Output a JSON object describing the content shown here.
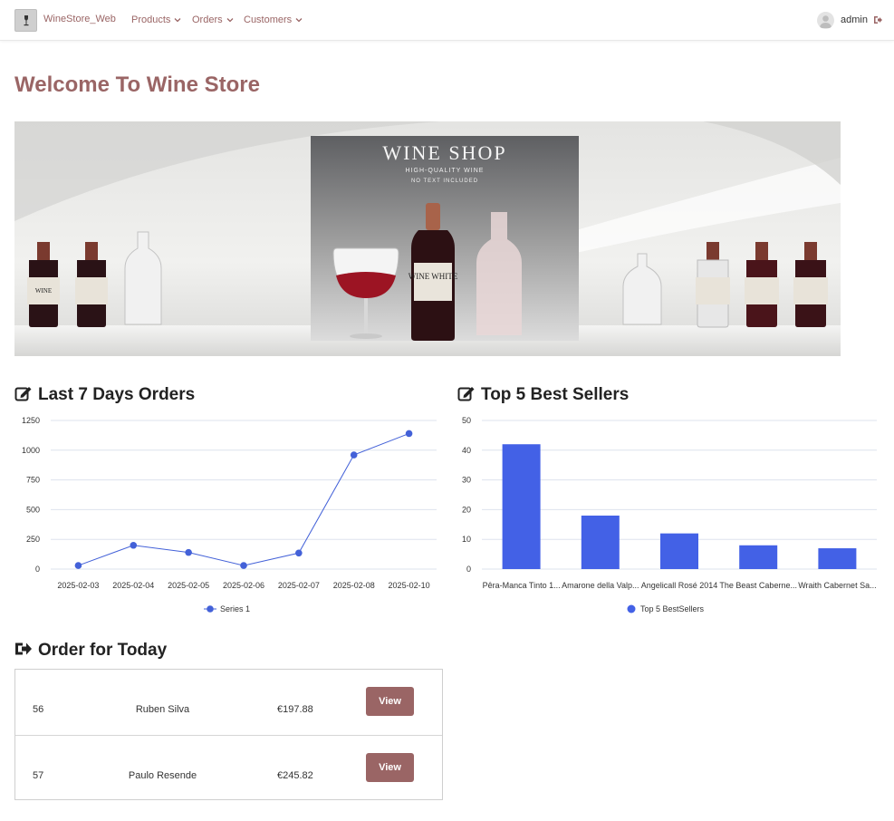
{
  "navbar": {
    "brand": "WineStore_Web",
    "menu": [
      {
        "label": "Products"
      },
      {
        "label": "Orders"
      },
      {
        "label": "Customers"
      }
    ],
    "user": "admin"
  },
  "page": {
    "title": "Welcome To Wine Store"
  },
  "banner": {
    "headline": "WINE SHOP",
    "sub1": "HIGH-QUALITY WINE",
    "sub2": "NO TEXT INCLUDED",
    "bottle_label": "WINE WHITE",
    "side_label": "WINE"
  },
  "sections": {
    "orders_chart_title": "Last 7 Days Orders",
    "sellers_chart_title": "Top 5 Best Sellers",
    "today_title": "Order for Today"
  },
  "chart_data": [
    {
      "type": "line",
      "title": "Last 7 Days Orders",
      "x": [
        "2025-02-03",
        "2025-02-04",
        "2025-02-05",
        "2025-02-06",
        "2025-02-07",
        "2025-02-08",
        "2025-02-10"
      ],
      "series": [
        {
          "name": "Series 1",
          "values": [
            30,
            200,
            140,
            30,
            135,
            960,
            1140
          ],
          "color": "#4361d8"
        }
      ],
      "ylim": [
        0,
        1250
      ],
      "yticks": [
        "0",
        "250",
        "500",
        "750",
        "1000",
        "1250"
      ],
      "grid": true,
      "legend": "bottom"
    },
    {
      "type": "bar",
      "title": "Top 5 Best Sellers",
      "categories": [
        "Pêra-Manca Tinto 1...",
        "Amarone della Valp...",
        "Angelicall Rosé 2014",
        "The Beast Caberne...",
        "Wraith Cabernet Sa..."
      ],
      "series": [
        {
          "name": "Top 5 BestSellers",
          "values": [
            42,
            18,
            12,
            8,
            7
          ],
          "color": "#4361e6"
        }
      ],
      "ylim": [
        0,
        50
      ],
      "yticks": [
        "0",
        "10",
        "20",
        "30",
        "40",
        "50"
      ],
      "grid": true,
      "legend": "bottom"
    }
  ],
  "orders_today": {
    "rows": [
      {
        "id": "56",
        "customer": "Ruben Silva",
        "total": "€197.88",
        "action": "View"
      },
      {
        "id": "57",
        "customer": "Paulo Resende",
        "total": "€245.82",
        "action": "View"
      }
    ]
  },
  "colors": {
    "accent": "#9a6565",
    "chart_blue": "#4361e6"
  }
}
